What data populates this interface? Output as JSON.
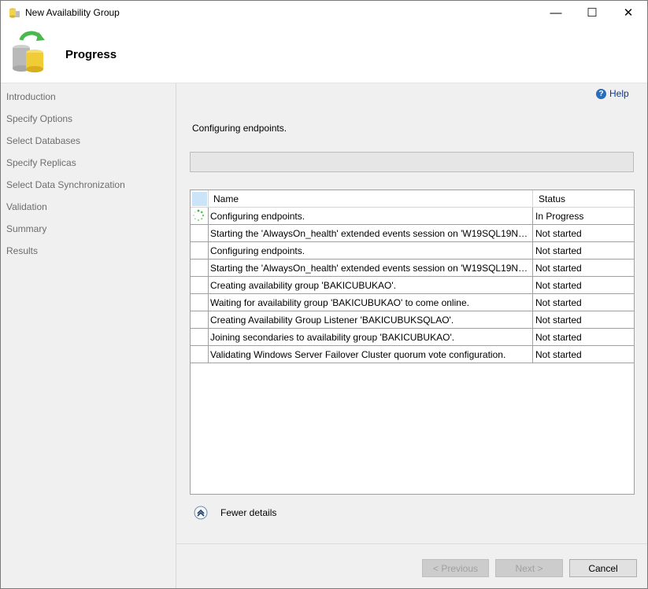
{
  "window": {
    "title": "New Availability Group",
    "minimize_glyph": "—",
    "maximize_glyph": "☐",
    "close_glyph": "✕"
  },
  "header": {
    "title": "Progress",
    "icon": "database-cylinders-icon"
  },
  "sidebar": {
    "items": [
      {
        "label": "Introduction"
      },
      {
        "label": "Specify Options"
      },
      {
        "label": "Select Databases"
      },
      {
        "label": "Specify Replicas"
      },
      {
        "label": "Select Data Synchronization"
      },
      {
        "label": "Validation"
      },
      {
        "label": "Summary"
      },
      {
        "label": "Results"
      }
    ]
  },
  "main": {
    "help_label": "Help",
    "status_message": "Configuring endpoints.",
    "progress_fraction": 0,
    "columns": {
      "name": "Name",
      "status": "Status"
    },
    "rows": [
      {
        "name": "Configuring endpoints.",
        "status": "In Progress",
        "icon": "spinner-icon"
      },
      {
        "name": "Starting the 'AlwaysOn_health' extended events session on 'W19SQL19NOD...",
        "status": "Not started"
      },
      {
        "name": "Configuring endpoints.",
        "status": "Not started"
      },
      {
        "name": "Starting the 'AlwaysOn_health' extended events session on 'W19SQL19NOD...",
        "status": "Not started"
      },
      {
        "name": "Creating availability group 'BAKICUBUKAO'.",
        "status": "Not started"
      },
      {
        "name": "Waiting for availability group 'BAKICUBUKAO' to come online.",
        "status": "Not started"
      },
      {
        "name": "Creating Availability Group Listener 'BAKICUBUKSQLAO'.",
        "status": "Not started"
      },
      {
        "name": "Joining secondaries to availability group 'BAKICUBUKAO'.",
        "status": "Not started"
      },
      {
        "name": "Validating Windows Server Failover Cluster quorum vote configuration.",
        "status": "Not started"
      }
    ],
    "details_label": "Fewer details"
  },
  "footer": {
    "previous_label": "< Previous",
    "next_label": "Next >",
    "cancel_label": "Cancel"
  },
  "colors": {
    "sidebar_bg": "#f0f0f0",
    "help_link": "#0b3a8f",
    "spinner": "#3bbd3b"
  }
}
